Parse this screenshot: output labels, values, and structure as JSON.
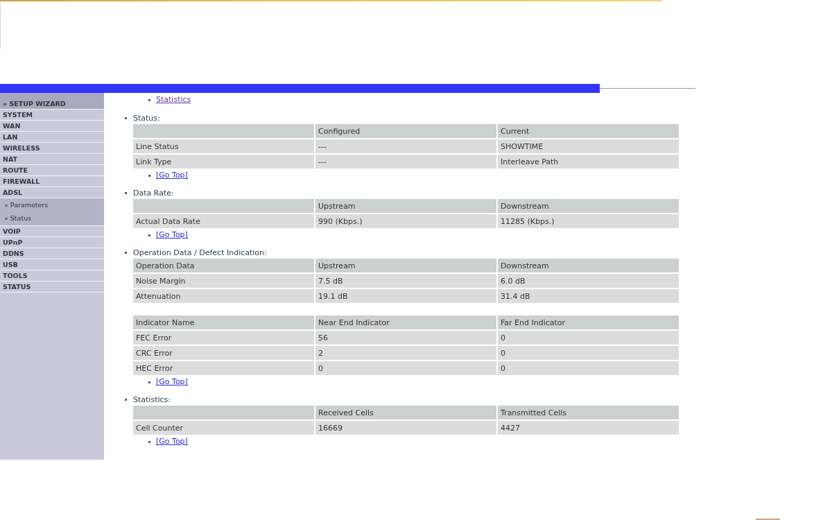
{
  "sidebar": {
    "items": [
      {
        "label": "» SETUP WIZARD",
        "kind": "wizard"
      },
      {
        "label": "SYSTEM",
        "kind": "menu"
      },
      {
        "label": "WAN",
        "kind": "menu"
      },
      {
        "label": "LAN",
        "kind": "menu"
      },
      {
        "label": "WIRELESS",
        "kind": "menu"
      },
      {
        "label": "NAT",
        "kind": "menu"
      },
      {
        "label": "ROUTE",
        "kind": "menu"
      },
      {
        "label": "FIREWALL",
        "kind": "menu"
      },
      {
        "label": "ADSL",
        "kind": "menu",
        "children": [
          {
            "label": "» Parameters"
          },
          {
            "label": "» Status"
          }
        ]
      },
      {
        "label": "VOIP",
        "kind": "menu"
      },
      {
        "label": "UPnP",
        "kind": "menu"
      },
      {
        "label": "DDNS",
        "kind": "menu"
      },
      {
        "label": "USB",
        "kind": "menu"
      },
      {
        "label": "TOOLS",
        "kind": "menu"
      },
      {
        "label": "STATUS",
        "kind": "menu"
      }
    ]
  },
  "content": {
    "links": [
      {
        "label": "Statistics",
        "visited": true
      }
    ],
    "sections": [
      {
        "title": "Status:",
        "tables": [
          {
            "columns": [
              "Configured",
              "Current"
            ],
            "rows": [
              {
                "label": "Line Status",
                "cells": [
                  "---",
                  "SHOWTIME"
                ]
              },
              {
                "label": "Link Type",
                "cells": [
                  "---",
                  "Interleave Path"
                ]
              }
            ]
          }
        ],
        "go_top": {
          "label": "[Go Top]",
          "visited": false
        }
      },
      {
        "title": "Data Rate:",
        "tables": [
          {
            "columns": [
              "Upstream",
              "Downstream"
            ],
            "rows": [
              {
                "label": "Actual Data Rate",
                "cells": [
                  "990 (Kbps.)",
                  "11285 (Kbps.)"
                ]
              }
            ]
          }
        ],
        "go_top": {
          "label": "[Go Top]",
          "visited": false
        }
      },
      {
        "title": "Operation Data / Defect Indication:",
        "tables": [
          {
            "row_heading": "Operation Data",
            "columns": [
              "Upstream",
              "Downstream"
            ],
            "rows": [
              {
                "label": "Noise Margin",
                "cells": [
                  "7.5 dB",
                  "6.0 dB"
                ]
              },
              {
                "label": "Attenuation",
                "cells": [
                  "19.1 dB",
                  "31.4 dB"
                ]
              }
            ]
          },
          {
            "row_heading": "Indicator Name",
            "columns": [
              "Near End Indicator",
              "Far End Indicator"
            ],
            "rows": [
              {
                "label": "FEC Error",
                "cells": [
                  "56",
                  "0"
                ]
              },
              {
                "label": "CRC Error",
                "cells": [
                  "2",
                  "0"
                ]
              },
              {
                "label": "HEC Error",
                "cells": [
                  "0",
                  "0"
                ]
              }
            ]
          }
        ],
        "go_top": {
          "label": "[Go Top]",
          "visited": false
        }
      },
      {
        "title": "Statistics:",
        "tables": [
          {
            "columns": [
              "Received Cells",
              "Transmitted Cells"
            ],
            "rows": [
              {
                "label": "Cell Counter",
                "cells": [
                  "16669",
                  "4427"
                ]
              }
            ]
          }
        ],
        "go_top": {
          "label": "[Go Top]",
          "visited": false
        }
      }
    ]
  }
}
